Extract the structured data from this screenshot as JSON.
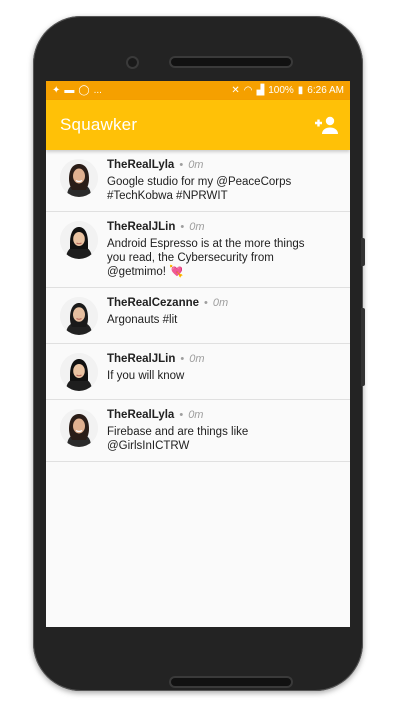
{
  "status_bar": {
    "battery": "100%",
    "time": "6:26 AM",
    "left_text": "..."
  },
  "app_bar": {
    "title": "Squawker",
    "action_icon": "person-add-icon"
  },
  "colors": {
    "status_bar": "#f5a000",
    "app_bar": "#ffc107",
    "text_primary": "#212121",
    "text_secondary": "#9e9e9e"
  },
  "messages": [
    {
      "author": "TheRealLyla",
      "separator": "•",
      "time": "0m",
      "text": "Google studio for my @PeaceCorps\n#TechKobwa #NPRWIT",
      "avatar": "lyla"
    },
    {
      "author": "TheRealJLin",
      "separator": "•",
      "time": "0m",
      "text": "Android Espresso is at the more things\nyou read, the Cybersecurity from\n@getmimo! 💘",
      "avatar": "jlin"
    },
    {
      "author": "TheRealCezanne",
      "separator": "•",
      "time": "0m",
      "text": "Argonauts #lit",
      "avatar": "cezanne"
    },
    {
      "author": "TheRealJLin",
      "separator": "•",
      "time": "0m",
      "text": "If you will know",
      "avatar": "jlin"
    },
    {
      "author": "TheRealLyla",
      "separator": "•",
      "time": "0m",
      "text": "Firebase and are things like\n@GirlsInICTRW",
      "avatar": "lyla"
    }
  ]
}
